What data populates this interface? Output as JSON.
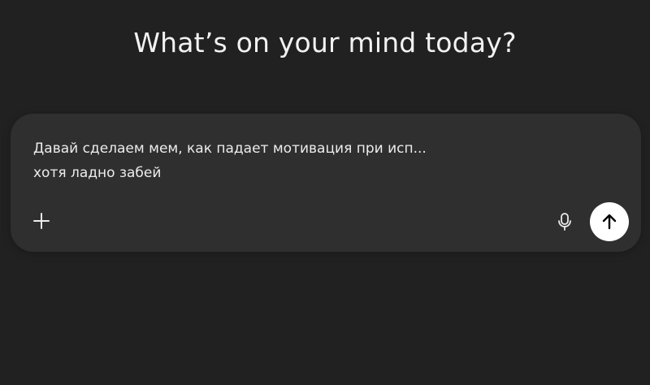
{
  "header": {
    "title": "What’s on your mind today?"
  },
  "composer": {
    "lines": [
      "Давай сделаем мем, как падает мотивация при исп...",
      "хотя ладно забей"
    ],
    "icons": {
      "add": "plus-icon",
      "voice": "microphone-icon",
      "send": "arrow-up-icon"
    }
  },
  "colors": {
    "background": "#212121",
    "composer": "#2f2f2f",
    "text": "#ececec",
    "send_button": "#ffffff",
    "send_icon": "#000000"
  }
}
